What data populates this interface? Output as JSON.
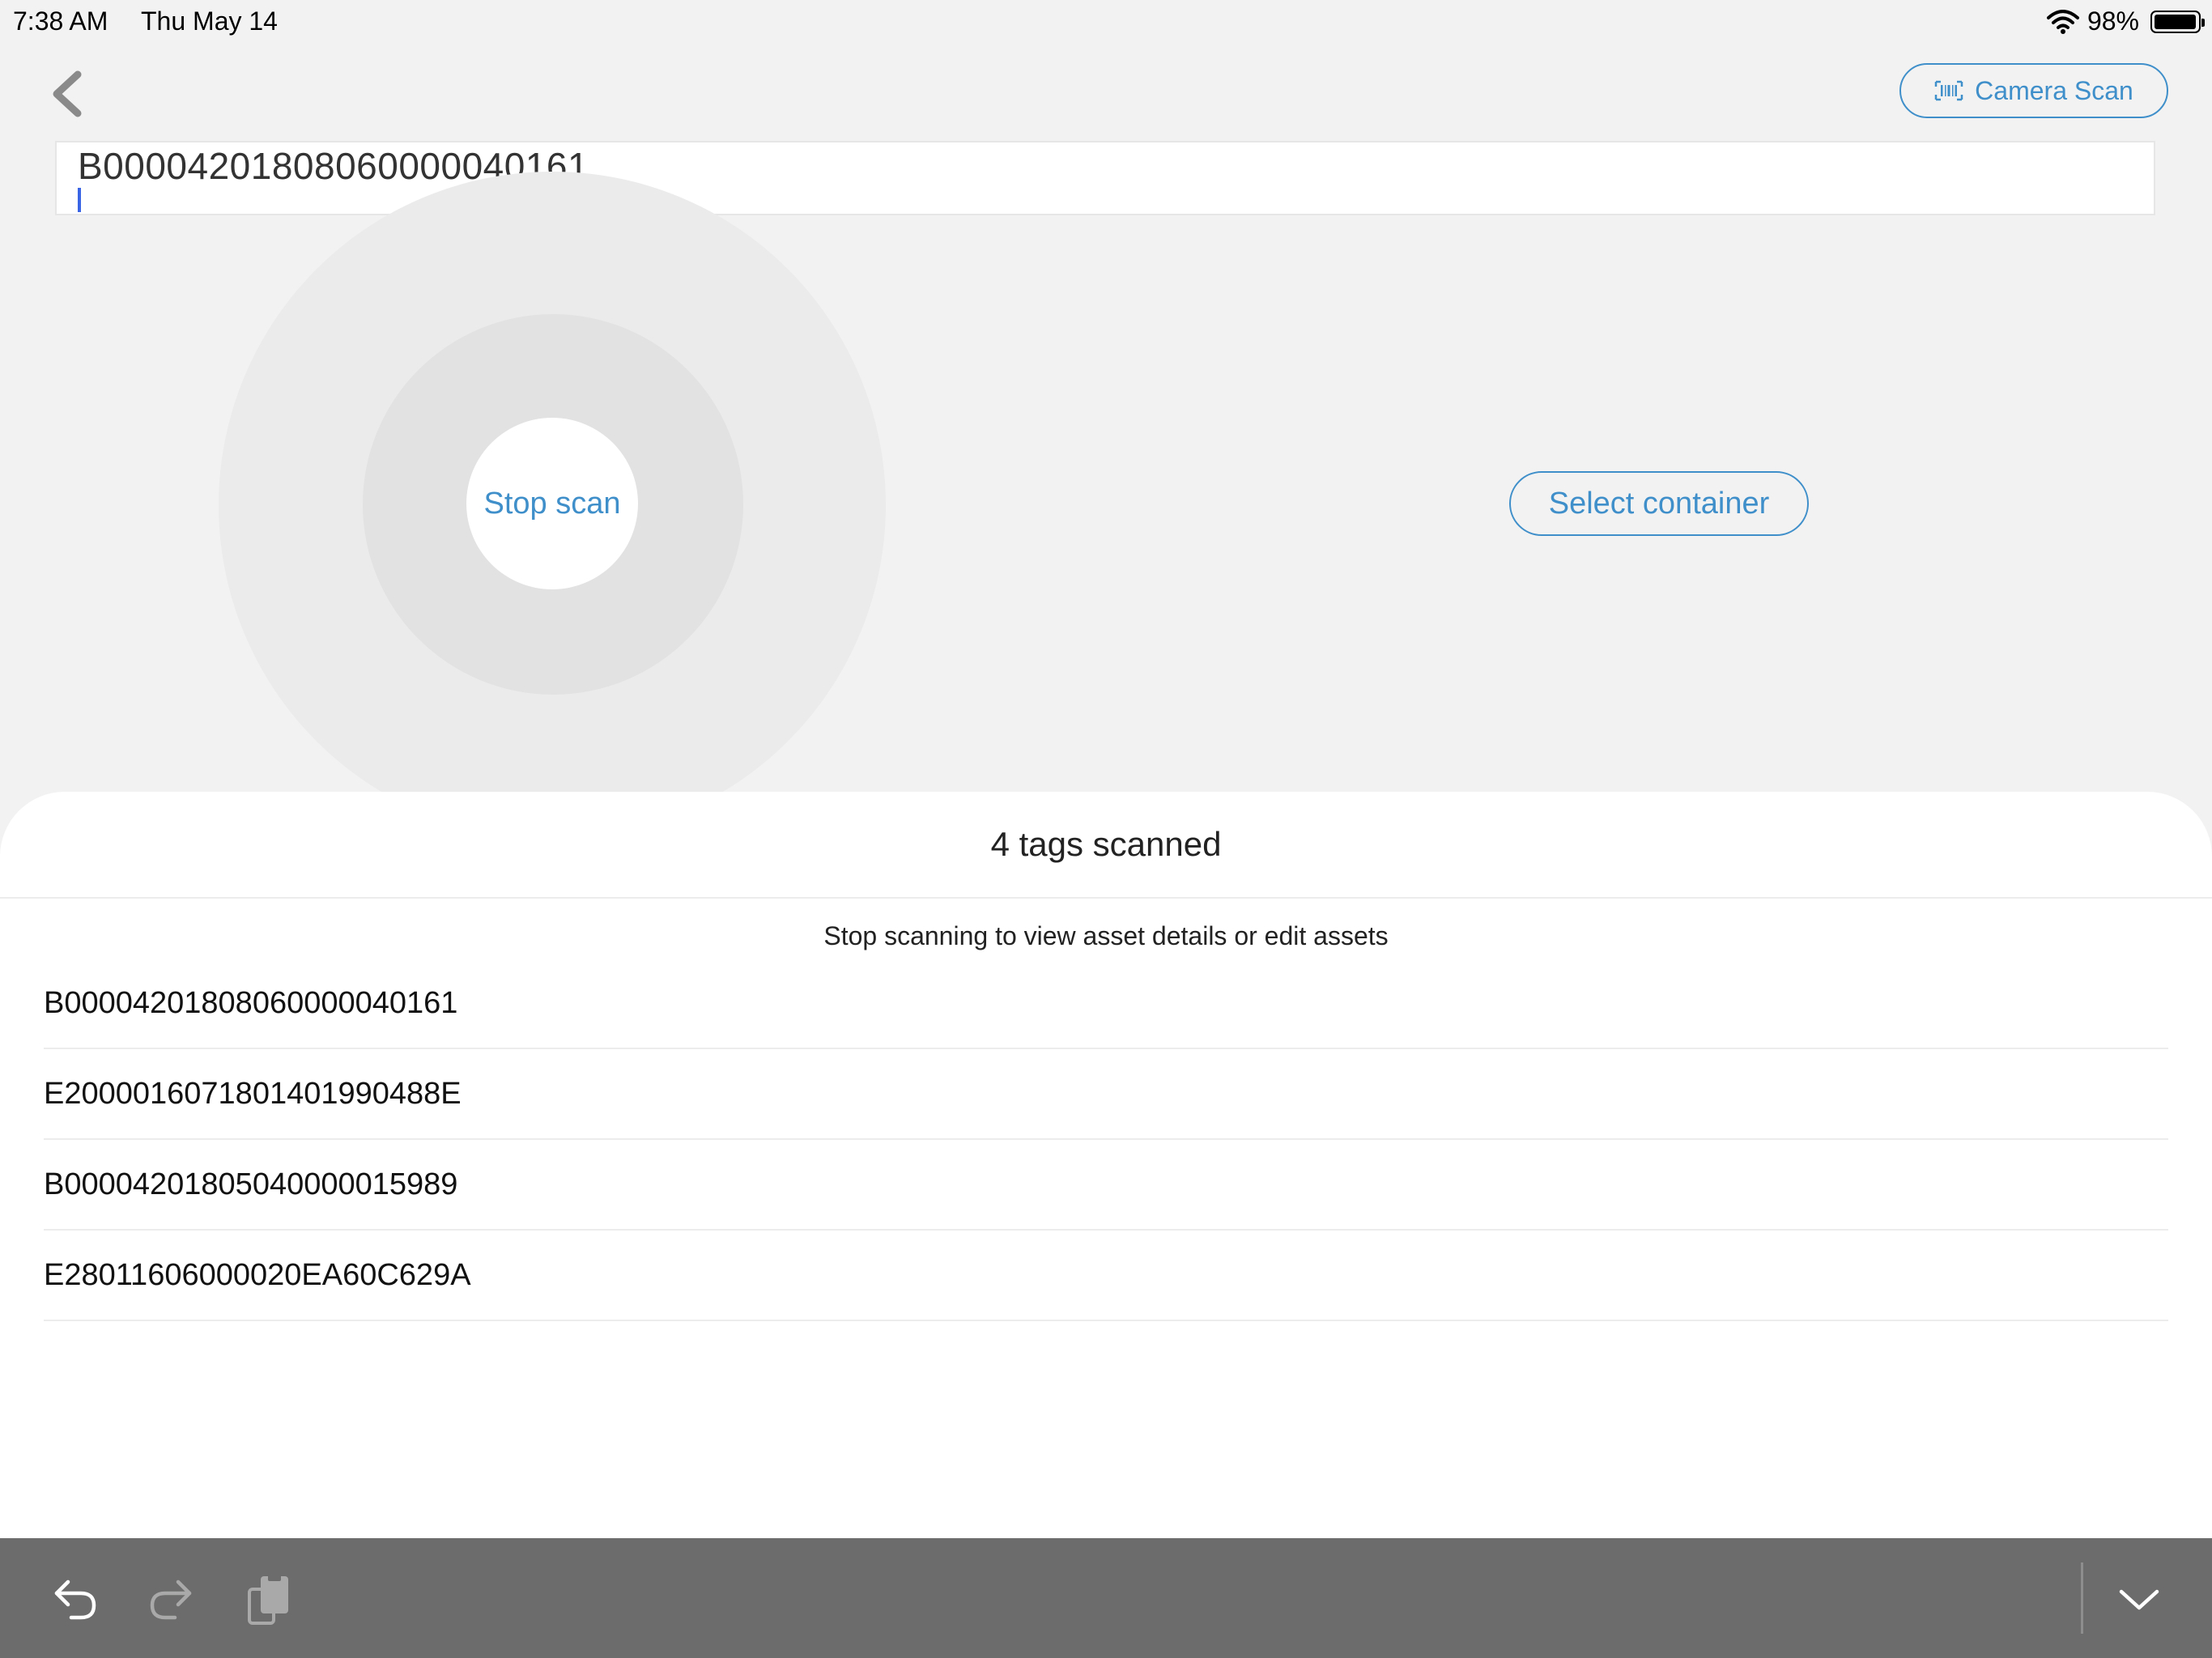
{
  "status_bar": {
    "time": "7:38 AM",
    "date": "Thu May 14",
    "battery": "98%",
    "battery_level": 0.98,
    "icons": [
      "wifi-icon",
      "battery-icon"
    ]
  },
  "nav": {
    "back_icon": "chevron-left-icon",
    "camera_scan_label": "Camera Scan",
    "camera_scan_icon": "barcode-icon"
  },
  "scan_input": {
    "value": "B00004201808060000040161"
  },
  "scanner": {
    "stop_scan_label": "Stop scan",
    "select_container_label": "Select container"
  },
  "results": {
    "title": "4 tags scanned",
    "hint": "Stop scanning to view asset details or edit assets",
    "tags": [
      "B00004201808060000040161",
      "E2000016071801401990488E",
      "B00004201805040000015989",
      "E28011606000020EA60C629A"
    ]
  },
  "shortcut_bar": {
    "icons": [
      "undo-icon",
      "redo-icon",
      "paste-icon",
      "keyboard-dismiss-icon"
    ]
  },
  "colors": {
    "accent": "#3f8fca",
    "background": "#f2f2f2",
    "toolbar": "#6b6c6b"
  }
}
